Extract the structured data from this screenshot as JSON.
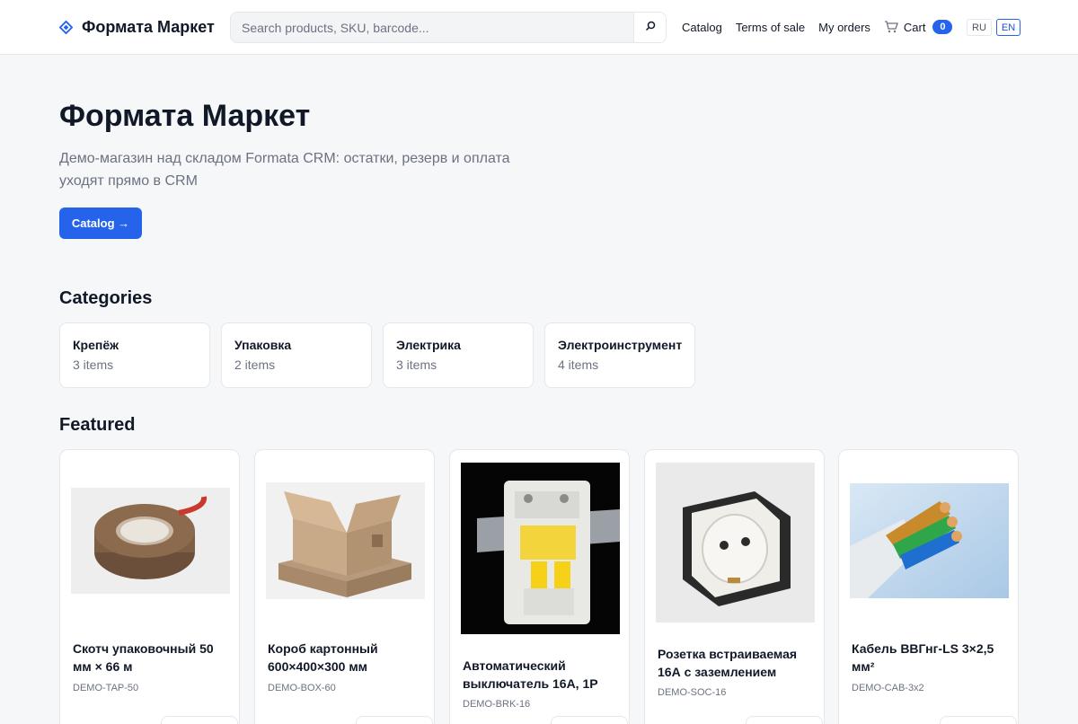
{
  "header": {
    "logo_text": "Формата Маркет",
    "search_placeholder": "Search products, SKU, barcode...",
    "nav": [
      "Catalog",
      "Terms of sale",
      "My orders"
    ],
    "cart_label": "Cart",
    "cart_count": "0",
    "languages": [
      "RU",
      "EN"
    ],
    "active_language": "EN"
  },
  "hero": {
    "title": "Формата Маркет",
    "subtitle": "Демо-магазин над складом Formata CRM: остатки, резерв и оплата уходят прямо в CRM",
    "cta_label": "Catalog →"
  },
  "categories": {
    "title": "Categories",
    "items": [
      {
        "name": "Крепёж",
        "count": "3 items"
      },
      {
        "name": "Упаковка",
        "count": "2 items"
      },
      {
        "name": "Электрика",
        "count": "3 items"
      },
      {
        "name": "Электроинструмент",
        "count": "4 items"
      }
    ]
  },
  "featured": {
    "title": "Featured",
    "products": [
      {
        "name": "Скотч упаковочный 50 мм × 66 м",
        "sku": "DEMO-TAP-50",
        "image": "packing-tape-image"
      },
      {
        "name": "Короб картонный 600×400×300 мм",
        "sku": "DEMO-BOX-60",
        "image": "cardboard-box-image"
      },
      {
        "name": "Автоматический выключатель 16А, 1P",
        "sku": "DEMO-BRK-16",
        "image": "circuit-breaker-image"
      },
      {
        "name": "Розетка встраиваемая 16А с заземлением",
        "sku": "DEMO-SOC-16",
        "image": "power-socket-image"
      },
      {
        "name": "Кабель ВВГнг-LS 3×2,5 мм²",
        "sku": "DEMO-CAB-3x2",
        "image": "power-cable-image"
      }
    ]
  },
  "colors": {
    "accent": "#2563eb",
    "background": "#f6f7f9",
    "text": "#111827",
    "muted": "#6b7280"
  }
}
